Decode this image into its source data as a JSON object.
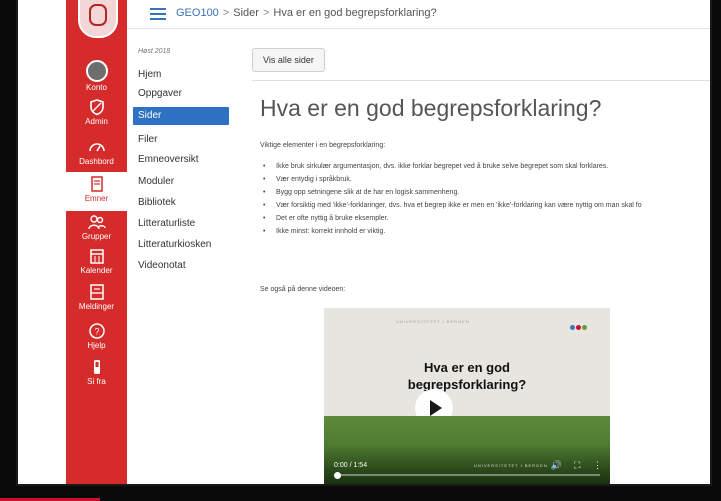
{
  "breadcrumb": {
    "course": "GEO100",
    "section": "Sider",
    "page": "Hva er en god begrepsforklaring?"
  },
  "global_nav": [
    {
      "label": "Konto",
      "icon": "avatar"
    },
    {
      "label": "Admin",
      "icon": "shield-icon"
    },
    {
      "label": "Dashbord",
      "icon": "dashboard-icon"
    },
    {
      "label": "Emner",
      "icon": "book-icon",
      "active": true
    },
    {
      "label": "Grupper",
      "icon": "groups-icon"
    },
    {
      "label": "Kalender",
      "icon": "calendar-icon"
    },
    {
      "label": "Meldinger",
      "icon": "inbox-icon"
    },
    {
      "label": "Hjelp",
      "icon": "help-icon"
    },
    {
      "label": "Si fra",
      "icon": "feedback-icon"
    }
  ],
  "course_nav": {
    "term": "Høst 2018",
    "items": [
      "Hjem",
      "Oppgaver",
      "Sider",
      "Filer",
      "Emneoversikt",
      "Moduler",
      "Bibliotek",
      "Litteraturliste",
      "Litteraturkiosken",
      "Videonotat"
    ]
  },
  "content": {
    "view_all_button": "Vis alle sider",
    "title": "Hva er en god begrepsforklaring?",
    "intro": "Viktige elementer i en begrepsforklaring:",
    "bullets": [
      "Ikke bruk sirkulær argumentasjon, dvs. ikke forklar begrepet ved å bruke selve begrepet som skal forklares.",
      "Vær entydig i språkbruk.",
      "Bygg opp setningene slik at de har en logisk sammenheng.",
      "Vær forsiktig med 'ikke'-forklaringer, dvs. hva et begrep ikke er men en 'ikke'-forklaring kan være nyttig om man skal fo",
      "Det er ofte nyttig å bruke eksempler.",
      "Ikke minst: korrekt innhold er viktig."
    ],
    "see_also": "Se også på denne videoen:"
  },
  "video": {
    "title_line1": "Hva er en god",
    "title_line2": "begrepsforklaring?",
    "brand": "UNIVERSITETET I BERGEN",
    "time": "0:00 / 1:54",
    "progress": 0
  },
  "colors": {
    "sidebar": "#d52b2b",
    "active_nav": "#2d72c2",
    "link": "#3a73b8"
  }
}
